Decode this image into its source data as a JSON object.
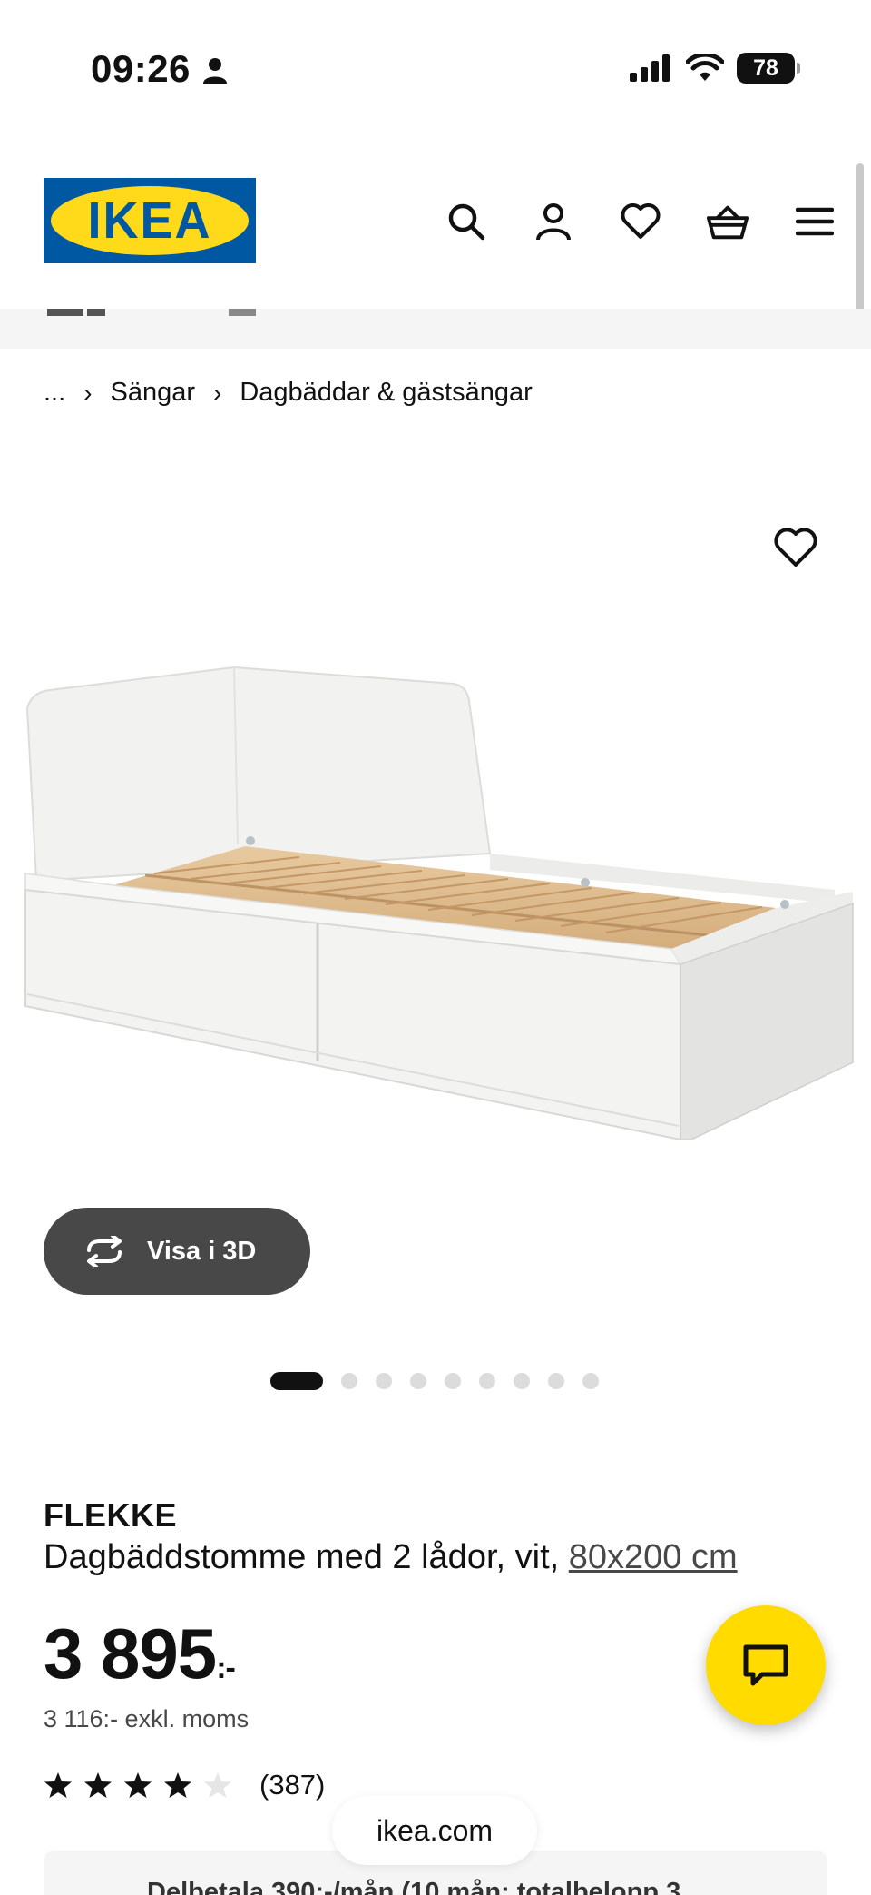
{
  "status_bar": {
    "time": "09:26",
    "battery": "78",
    "icons": [
      "person-icon",
      "signal-icon",
      "wifi-icon",
      "battery-icon"
    ]
  },
  "header": {
    "logo_text": "IKEA",
    "logo_reg": "®",
    "icons": [
      "search-icon",
      "user-icon",
      "heart-icon",
      "basket-icon",
      "menu-icon"
    ],
    "brand_colors": {
      "blue": "#0058a3",
      "yellow": "#ffda1a"
    }
  },
  "breadcrumb": {
    "ellipsis": "...",
    "items": [
      "Sängar",
      "Dagbäddar & gästsängar"
    ]
  },
  "gallery": {
    "view_3d_label": "Visa i 3D",
    "dot_count": 9,
    "active_dot": 1
  },
  "product": {
    "name": "FLEKKE",
    "description": "Dagbäddstomme med 2 lådor, vit, ",
    "size": "80x200 cm",
    "price": "3 895",
    "price_suffix": ":-",
    "price_ex_vat": "3 116:- exkl. moms",
    "rating": 4.0,
    "rating_max": 5,
    "review_count": "(387)"
  },
  "installment": {
    "text": "Delbetala 390:-/mån (10 mån; totalbelopp 3"
  },
  "browser": {
    "url": "ikea.com"
  },
  "colors": {
    "accent_yellow": "#ffdb00",
    "dark_button": "#484848"
  }
}
